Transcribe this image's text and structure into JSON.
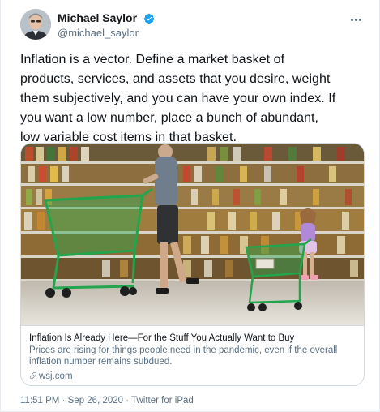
{
  "author": {
    "display_name": "Michael Saylor",
    "handle": "@michael_saylor",
    "verified": true,
    "verified_color": "#1da1f2"
  },
  "tweet": {
    "lines": [
      "Inflation is a vector.  Define a market basket of",
      "products, services, and assets that you desire, weight",
      "them subjectively, and you can have your own index.  If",
      "you want a low number, place a bunch of abundant,",
      "low variable cost items in that basket."
    ]
  },
  "card": {
    "title": "Inflation Is Already Here—For the Stuff You Actually Want to Buy",
    "description_lines": [
      "Prices are rising for things people need in the pandemic, even if the overall",
      "inflation number remains subdued."
    ],
    "domain": "wsj.com"
  },
  "meta": {
    "time": "11:51 PM",
    "date": "Sep 26, 2020",
    "separator": "·",
    "source": "Twitter for iPad"
  },
  "icons": {
    "verified": "verified-badge-icon",
    "more": "more-options-icon",
    "link": "link-icon"
  },
  "colors": {
    "text": "#0f1419",
    "secondary": "#5b7083",
    "border": "#cfd9de",
    "cart_green": "#1f9d48"
  }
}
